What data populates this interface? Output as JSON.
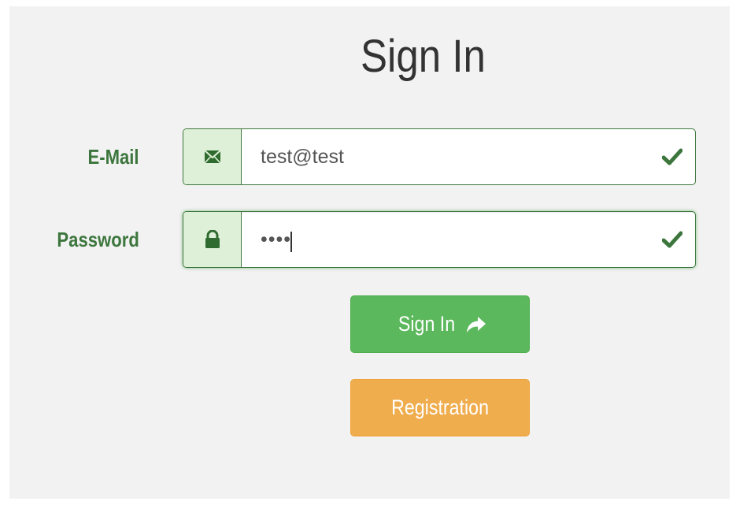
{
  "form": {
    "title": "Sign In",
    "email": {
      "label": "E-Mail",
      "value": "test@test",
      "icon": "envelope-icon",
      "status": "valid"
    },
    "password": {
      "label": "Password",
      "value": "••••",
      "icon": "lock-icon",
      "status": "valid",
      "focused": true
    },
    "signin_button": {
      "label": "Sign In",
      "icon": "share-arrow-icon"
    },
    "registration_button": {
      "label": "Registration"
    }
  },
  "colors": {
    "label_green": "#3c763d",
    "addon_bg": "#dff0d8",
    "success_button": "#5cb85c",
    "warning_button": "#f0ad4e",
    "panel_bg": "#f2f2f2"
  }
}
